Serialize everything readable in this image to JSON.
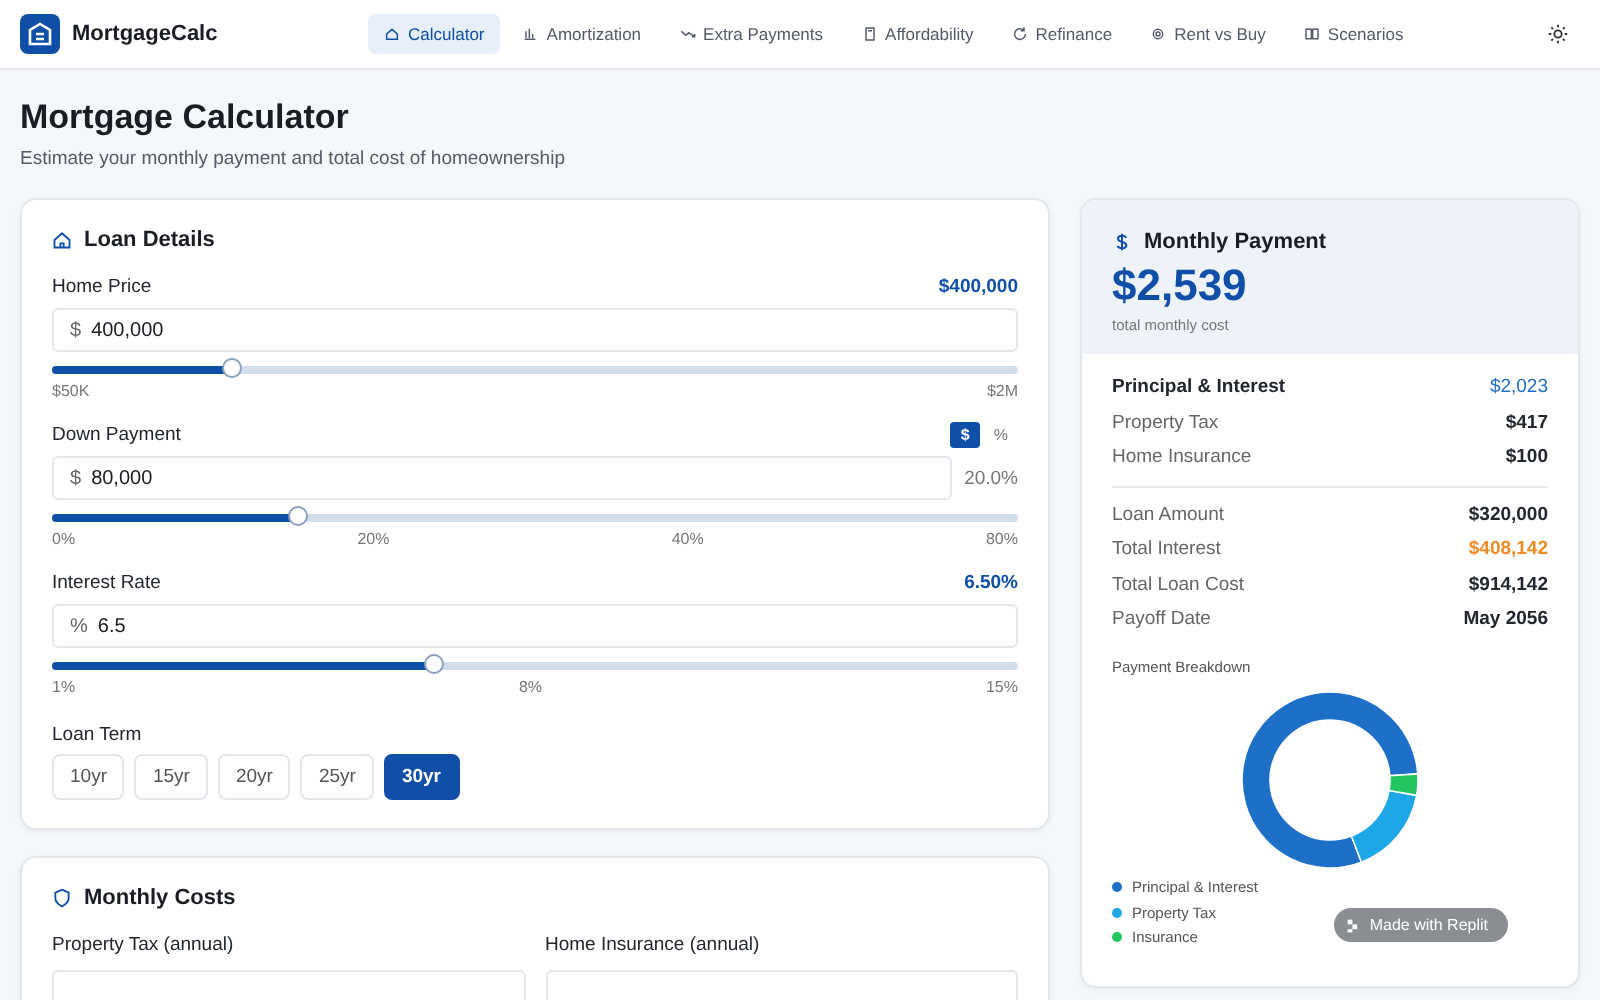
{
  "app": {
    "name": "MortgageCalc"
  },
  "nav": [
    {
      "label": "Calculator",
      "selected": true
    },
    {
      "label": "Amortization",
      "selected": false
    },
    {
      "label": "Extra Payments",
      "selected": false
    },
    {
      "label": "Affordability",
      "selected": false
    },
    {
      "label": "Refinance",
      "selected": false
    },
    {
      "label": "Rent vs Buy",
      "selected": false
    },
    {
      "label": "Scenarios",
      "selected": false
    }
  ],
  "page": {
    "title": "Mortgage Calculator",
    "subtitle": "Estimate your monthly payment and total cost of homeownership"
  },
  "loan_details": {
    "title": "Loan Details",
    "home_price": {
      "label": "Home Price",
      "reading": "$400,000",
      "prefix": "$",
      "value": "400,000",
      "level": 0.186,
      "ticks": [
        "$50K",
        "$2M"
      ]
    },
    "down_payment": {
      "label": "Down Payment",
      "modes": [
        {
          "label": "$",
          "selected": true
        },
        {
          "label": "%",
          "selected": false
        }
      ],
      "prefix": "$",
      "value": "80,000",
      "percent": "20.0%",
      "level": 0.255,
      "ticks": [
        "0%",
        "20%",
        "40%",
        "80%"
      ]
    },
    "interest_rate": {
      "label": "Interest Rate",
      "reading": "6.50%",
      "prefix": "%",
      "value": "6.5",
      "level": 0.395,
      "ticks": [
        "1%",
        "8%",
        "15%"
      ]
    },
    "loan_term": {
      "label": "Loan Term",
      "options": [
        {
          "label": "10yr",
          "selected": false
        },
        {
          "label": "15yr",
          "selected": false
        },
        {
          "label": "20yr",
          "selected": false
        },
        {
          "label": "25yr",
          "selected": false
        },
        {
          "label": "30yr",
          "selected": true
        }
      ]
    }
  },
  "monthly_costs": {
    "title": "Monthly Costs",
    "fields": [
      {
        "label": "Property Tax (annual)"
      },
      {
        "label": "Home Insurance (annual)"
      }
    ]
  },
  "summary": {
    "title": "Monthly Payment",
    "amount": "$2,539",
    "caption": "total monthly cost",
    "breakdown": [
      {
        "label": "Principal & Interest",
        "value": "$2,023",
        "kind": "main"
      },
      {
        "label": "Property Tax",
        "value": "$417",
        "kind": "plain"
      },
      {
        "label": "Home Insurance",
        "value": "$100",
        "kind": "plain"
      }
    ],
    "totals": [
      {
        "label": "Loan Amount",
        "value": "$320,000",
        "kind": "plain"
      },
      {
        "label": "Total Interest",
        "value": "$408,142",
        "kind": "warn"
      },
      {
        "label": "Total Loan Cost",
        "value": "$914,142",
        "kind": "plain"
      },
      {
        "label": "Payoff Date",
        "value": "May 2056",
        "kind": "plain"
      }
    ],
    "chart_title": "Payment Breakdown",
    "chart_data": {
      "type": "donut",
      "categories": [
        "Principal & Interest",
        "Property Tax",
        "Insurance"
      ],
      "values": [
        79.7,
        16.4,
        3.9
      ],
      "legend": "bottom",
      "colors": [
        "#1e6fc8",
        "#1ea7e6",
        "#22c55e"
      ]
    }
  },
  "badge": {
    "label": "Made with Replit"
  }
}
